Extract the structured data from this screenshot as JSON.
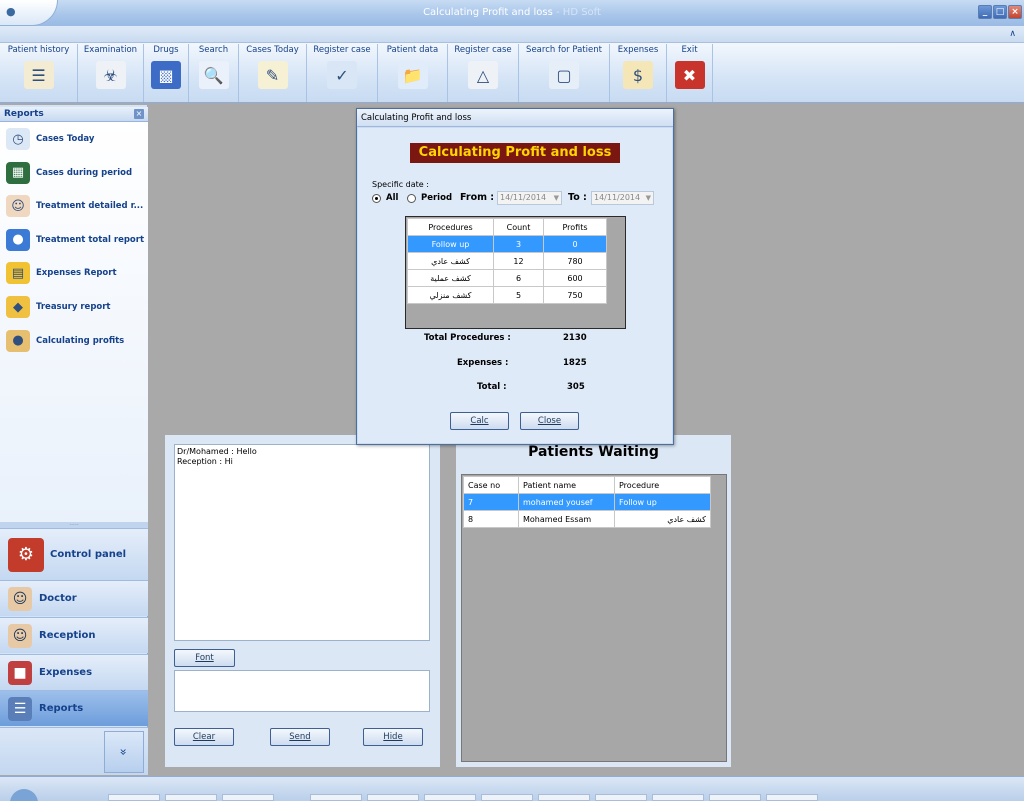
{
  "window": {
    "title": "Calculating Profit and loss",
    "title_suffix": " - HD Soft"
  },
  "ribbon": {
    "groups": [
      {
        "label": "Patient history",
        "icon": "patient-history-icon"
      },
      {
        "label": "Examination",
        "icon": "examination-icon"
      },
      {
        "label": "Drugs",
        "icon": "drugs-icon"
      },
      {
        "label": "Search",
        "icon": "search-icon"
      },
      {
        "label": "Cases Today",
        "icon": "cases-today-icon"
      },
      {
        "label": "Register case",
        "icon": "register-case-icon"
      },
      {
        "label": "Patient data",
        "icon": "patient-data-icon"
      },
      {
        "label": "Register case",
        "icon": "register-case-2-icon"
      },
      {
        "label": "Search for Patient",
        "icon": "search-patient-icon"
      },
      {
        "label": "Expenses",
        "icon": "money-bag-icon"
      },
      {
        "label": "Exit",
        "icon": "exit-icon"
      }
    ]
  },
  "reports": {
    "header": "Reports",
    "items": [
      {
        "label": "Cases Today",
        "icon": "clock-icon"
      },
      {
        "label": "Cases during period",
        "icon": "calendar-icon"
      },
      {
        "label": "Treatment detailed r...",
        "icon": "doctor-icon"
      },
      {
        "label": "Treatment total report",
        "icon": "pill-icon"
      },
      {
        "label": "Expenses Report",
        "icon": "bar-chart-icon"
      },
      {
        "label": "Treasury report",
        "icon": "treasury-icon"
      },
      {
        "label": "Calculating profits",
        "icon": "coins-icon"
      }
    ]
  },
  "nav": {
    "control_panel": "Control panel",
    "doctor": "Doctor",
    "reception": "Reception",
    "expenses": "Expenses",
    "reports": "Reports",
    "more": "»"
  },
  "chat": {
    "lines": [
      "Dr/Mohamed : Hello",
      "Reception : Hi"
    ],
    "font_button": "Font",
    "clear_button": "Clear",
    "send_button": "Send",
    "hide_button": "Hide"
  },
  "patients_waiting": {
    "title": "Patients Waiting",
    "columns": [
      "Case no",
      "Patient name",
      "Procedure"
    ],
    "rows": [
      {
        "case_no": "7",
        "name": "mohamed yousef",
        "procedure": "Follow up",
        "selected": true
      },
      {
        "case_no": "8",
        "name": "Mohamed Essam",
        "procedure": "كشف عادي",
        "selected": false
      }
    ]
  },
  "dialog": {
    "title": "Calculating Profit and loss",
    "banner": "Calculating Profit and loss",
    "specific_date_label": "Specific date :",
    "all_label": "All",
    "period_label": "Period",
    "from_label": "From :",
    "from_value": "14/11/2014",
    "to_label": "To :",
    "to_value": "14/11/2014",
    "mode": "All",
    "columns": [
      "Procedures",
      "Count",
      "Profits"
    ],
    "rows": [
      {
        "procedure": "Follow up",
        "count": "3",
        "profit": "0",
        "selected": true
      },
      {
        "procedure": "كشف عادي",
        "count": "12",
        "profit": "780",
        "selected": false
      },
      {
        "procedure": "كشف عملية",
        "count": "6",
        "profit": "600",
        "selected": false
      },
      {
        "procedure": "كشف منزلي",
        "count": "5",
        "profit": "750",
        "selected": false
      }
    ],
    "total_procedures_label": "Total Procedures :",
    "total_procedures_value": "2130",
    "expenses_label": "Expenses :",
    "expenses_value": "1825",
    "total_label": "Total :",
    "total_value": "305",
    "calc_button": "Calc",
    "close_button": "Close"
  },
  "colors": {
    "selection": "#3399ff",
    "banner_bg": "#7a1711",
    "banner_text": "#ffd400"
  }
}
